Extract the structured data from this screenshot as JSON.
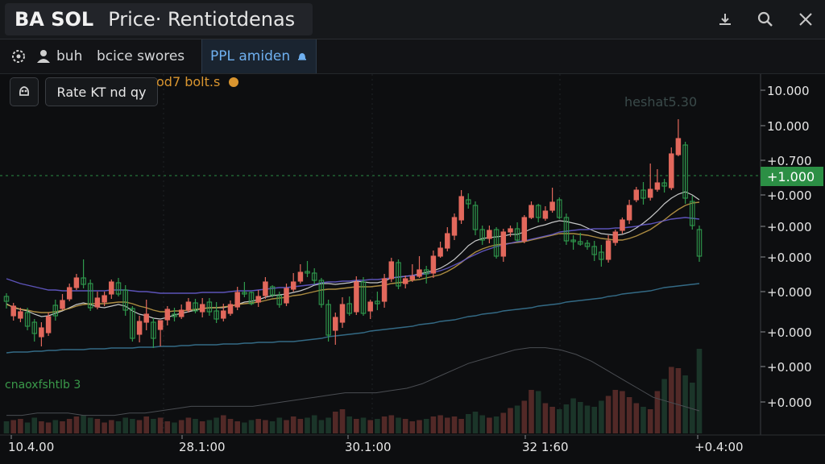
{
  "window": {
    "symbol": "BA SOL",
    "title": "Price· Rentiotdenas",
    "icons": [
      "download-icon",
      "search-icon",
      "close-icon"
    ]
  },
  "toolbar": {
    "item1_label": "buh",
    "item2_label": "bcice swores",
    "active_tab_label": "PPL amiden"
  },
  "chart_panel": {
    "rate_button_label": "Rate KT  nd  qy",
    "indicator_label": "od7 bolt.s",
    "watermark": "heshat5.30",
    "volume_label": "cnaoxfshtlb 3"
  },
  "colors": {
    "up": "#2f9a4d",
    "down": "#e2685c",
    "price_tag": "#2c8f45",
    "ma_fast": "#e8e8e8",
    "ma_mid": "#c9a24a",
    "ma_slow": "#6b5fd6",
    "ma_long": "#3b7a9a"
  },
  "chart_data": {
    "type": "candlestick",
    "price_axis_labels": [
      "10.000",
      "10.000",
      "+0.700",
      "+0.000",
      "+0.000",
      "+0.000",
      "+0.000",
      "+0.000",
      "+0.000",
      "+0.000"
    ],
    "current_price_tag": "+1.000",
    "time_axis_labels": [
      "10.4.00",
      "28.1:00",
      "30.1:00",
      "32 1:60",
      "+0.4:00"
    ],
    "candles": [
      [
        368,
        374,
        383,
        364,
        0
      ],
      [
        380,
        392,
        398,
        376,
        1
      ],
      [
        395,
        387,
        400,
        382,
        1
      ],
      [
        388,
        405,
        410,
        382,
        0
      ],
      [
        400,
        414,
        424,
        396,
        0
      ],
      [
        407,
        418,
        430,
        400,
        1
      ],
      [
        413,
        393,
        417,
        388,
        1
      ],
      [
        392,
        379,
        398,
        372,
        0
      ],
      [
        383,
        373,
        385,
        365,
        1
      ],
      [
        371,
        357,
        374,
        352,
        1
      ],
      [
        357,
        345,
        360,
        340,
        1
      ],
      [
        345,
        353,
        358,
        322,
        0
      ],
      [
        352,
        382,
        386,
        347,
        0
      ],
      [
        381,
        370,
        384,
        362,
        1
      ],
      [
        375,
        367,
        380,
        362,
        1
      ],
      [
        365,
        350,
        371,
        347,
        1
      ],
      [
        351,
        365,
        368,
        345,
        0
      ],
      [
        360,
        385,
        392,
        354,
        0
      ],
      [
        383,
        420,
        424,
        380,
        0
      ],
      [
        415,
        399,
        425,
        392,
        1
      ],
      [
        400,
        390,
        410,
        372,
        1
      ],
      [
        400,
        420,
        432,
        395,
        0
      ],
      [
        409,
        398,
        430,
        404,
        1
      ],
      [
        397,
        384,
        404,
        380,
        1
      ],
      [
        390,
        393,
        399,
        382,
        0
      ],
      [
        393,
        385,
        396,
        378,
        1
      ],
      [
        385,
        375,
        388,
        370,
        1
      ],
      [
        376,
        386,
        389,
        371,
        0
      ],
      [
        387,
        378,
        394,
        370,
        1
      ],
      [
        375,
        387,
        392,
        370,
        0
      ],
      [
        386,
        396,
        401,
        375,
        0
      ],
      [
        395,
        386,
        399,
        377,
        1
      ],
      [
        389,
        378,
        392,
        373,
        1
      ],
      [
        381,
        363,
        385,
        356,
        1
      ],
      [
        364,
        363,
        369,
        350,
        0
      ],
      [
        363,
        377,
        379,
        362,
        0
      ],
      [
        375,
        368,
        381,
        360,
        1
      ],
      [
        367,
        350,
        371,
        344,
        1
      ],
      [
        356,
        366,
        369,
        354,
        0
      ],
      [
        367,
        378,
        382,
        362,
        0
      ],
      [
        376,
        358,
        380,
        352,
        1
      ],
      [
        359,
        350,
        362,
        339,
        1
      ],
      [
        349,
        338,
        352,
        328,
        1
      ],
      [
        337,
        339,
        344,
        324,
        0
      ],
      [
        339,
        348,
        353,
        333,
        0
      ],
      [
        348,
        378,
        382,
        345,
        0
      ],
      [
        378,
        416,
        424,
        372,
        0
      ],
      [
        410,
        394,
        428,
        388,
        1
      ],
      [
        400,
        378,
        407,
        369,
        1
      ],
      [
        377,
        389,
        392,
        368,
        0
      ],
      [
        387,
        350,
        391,
        343,
        1
      ],
      [
        350,
        389,
        392,
        344,
        0
      ],
      [
        386,
        375,
        396,
        372,
        1
      ],
      [
        374,
        377,
        385,
        362,
        0
      ],
      [
        374,
        346,
        382,
        340,
        1
      ],
      [
        346,
        325,
        350,
        320,
        1
      ],
      [
        326,
        355,
        359,
        322,
        0
      ],
      [
        352,
        346,
        358,
        342,
        1
      ],
      [
        347,
        343,
        350,
        328,
        1
      ],
      [
        343,
        335,
        345,
        318,
        1
      ],
      [
        335,
        340,
        352,
        330,
        0
      ],
      [
        339,
        318,
        345,
        311,
        1
      ],
      [
        318,
        308,
        320,
        300,
        1
      ],
      [
        308,
        290,
        312,
        282,
        1
      ],
      [
        292,
        270,
        298,
        265,
        1
      ],
      [
        273,
        244,
        278,
        236,
        1
      ],
      [
        248,
        253,
        259,
        240,
        0
      ],
      [
        255,
        285,
        292,
        250,
        0
      ],
      [
        285,
        298,
        304,
        280,
        0
      ],
      [
        296,
        286,
        302,
        280,
        1
      ],
      [
        285,
        318,
        321,
        282,
        0
      ],
      [
        318,
        288,
        325,
        284,
        1
      ],
      [
        288,
        284,
        294,
        280,
        1
      ],
      [
        284,
        298,
        300,
        276,
        0
      ],
      [
        299,
        270,
        302,
        267,
        1
      ],
      [
        270,
        255,
        272,
        250,
        1
      ],
      [
        255,
        270,
        276,
        253,
        0
      ],
      [
        271,
        262,
        274,
        256,
        1
      ],
      [
        261,
        251,
        264,
        233,
        1
      ],
      [
        248,
        270,
        272,
        245,
        0
      ],
      [
        270,
        299,
        304,
        265,
        0
      ],
      [
        298,
        300,
        310,
        292,
        0
      ],
      [
        300,
        303,
        305,
        289,
        0
      ],
      [
        302,
        306,
        310,
        298,
        0
      ],
      [
        306,
        316,
        324,
        299,
        0
      ],
      [
        313,
        322,
        331,
        304,
        0
      ],
      [
        322,
        299,
        326,
        292,
        1
      ],
      [
        301,
        288,
        305,
        285,
        1
      ],
      [
        286,
        273,
        290,
        270,
        1
      ],
      [
        273,
        255,
        278,
        248,
        1
      ],
      [
        248,
        236,
        251,
        232,
        1
      ],
      [
        236,
        246,
        254,
        226,
        0
      ],
      [
        245,
        235,
        249,
        203,
        1
      ],
      [
        235,
        227,
        238,
        210,
        1
      ],
      [
        227,
        231,
        239,
        222,
        0
      ],
      [
        233,
        191,
        236,
        183,
        1
      ],
      [
        192,
        172,
        194,
        148,
        1
      ],
      [
        180,
        246,
        253,
        176,
        0
      ],
      [
        250,
        280,
        285,
        243,
        0
      ],
      [
        285,
        318,
        325,
        280,
        0
      ]
    ],
    "overlay_lines": [
      {
        "name": "ma-fast",
        "values": [
          377,
          382,
          384,
          386,
          390,
          393,
          392,
          389,
          386,
          382,
          378,
          376,
          378,
          381,
          382,
          380,
          378,
          380,
          386,
          390,
          392,
          395,
          396,
          394,
          391,
          389,
          387,
          385,
          383,
          382,
          382,
          382,
          380,
          378,
          375,
          374,
          372,
          369,
          367,
          366,
          365,
          363,
          361,
          358,
          354,
          352,
          352,
          353,
          352,
          351,
          349,
          350,
          351,
          351,
          349,
          345,
          344,
          343,
          342,
          340,
          338,
          336,
          333,
          328,
          322,
          314,
          305,
          299,
          296,
          295,
          294,
          293,
          291,
          291,
          288,
          284,
          281,
          279,
          276,
          274,
          275,
          277,
          279,
          283,
          287,
          290,
          291,
          292,
          291,
          288,
          283,
          277,
          270,
          262,
          253,
          246,
          241,
          238,
          242,
          248
        ]
      },
      {
        "name": "ma-mid",
        "values": [
          378,
          381,
          384,
          385,
          387,
          388,
          388,
          387,
          385,
          383,
          380,
          378,
          377,
          377,
          377,
          376,
          375,
          375,
          377,
          380,
          382,
          385,
          387,
          387,
          386,
          386,
          385,
          384,
          383,
          382,
          382,
          381,
          380,
          378,
          377,
          376,
          375,
          373,
          371,
          370,
          369,
          367,
          366,
          364,
          362,
          360,
          359,
          359,
          358,
          357,
          356,
          356,
          356,
          355,
          354,
          352,
          351,
          350,
          348,
          347,
          345,
          343,
          341,
          337,
          332,
          326,
          319,
          313,
          309,
          306,
          304,
          303,
          302,
          301,
          300,
          298,
          296,
          294,
          292,
          290,
          290,
          290,
          291,
          292,
          294,
          296,
          297,
          298,
          298,
          296,
          293,
          289,
          285,
          279,
          273,
          266,
          260,
          255,
          252,
          251
        ]
      },
      {
        "name": "ma-slow",
        "values": [
          346,
          349,
          352,
          354,
          356,
          358,
          360,
          360,
          361,
          361,
          361,
          361,
          361,
          361,
          361,
          360,
          360,
          360,
          361,
          362,
          362,
          363,
          364,
          364,
          364,
          364,
          364,
          364,
          363,
          363,
          363,
          363,
          362,
          361,
          361,
          361,
          360,
          359,
          358,
          357,
          357,
          356,
          355,
          354,
          353,
          351,
          350,
          350,
          349,
          349,
          348,
          348,
          347,
          347,
          346,
          345,
          344,
          343,
          342,
          341,
          340,
          338,
          336,
          333,
          329,
          325,
          320,
          316,
          312,
          309,
          306,
          304,
          302,
          300,
          299,
          297,
          295,
          293,
          291,
          288,
          287,
          286,
          285,
          285,
          284,
          284,
          284,
          283,
          283,
          282,
          281,
          279,
          278,
          276,
          274,
          272,
          271,
          270,
          271,
          272
        ]
      },
      {
        "name": "ma-long",
        "values": [
          438,
          437,
          437,
          437,
          436,
          436,
          435,
          435,
          434,
          434,
          434,
          434,
          433,
          433,
          433,
          432,
          432,
          432,
          432,
          431,
          431,
          431,
          430,
          430,
          430,
          429,
          429,
          428,
          428,
          428,
          428,
          427,
          427,
          427,
          426,
          426,
          425,
          425,
          425,
          424,
          424,
          424,
          423,
          422,
          421,
          420,
          418,
          417,
          416,
          415,
          414,
          413,
          411,
          410,
          409,
          408,
          407,
          406,
          405,
          403,
          402,
          401,
          399,
          398,
          397,
          395,
          393,
          392,
          390,
          389,
          388,
          386,
          385,
          384,
          383,
          382,
          380,
          379,
          378,
          377,
          375,
          374,
          373,
          372,
          371,
          370,
          368,
          367,
          365,
          364,
          363,
          362,
          361,
          359,
          357,
          356,
          355,
          354,
          353,
          352
        ]
      }
    ],
    "volume_values": [
      20,
      22,
      24,
      18,
      26,
      20,
      18,
      22,
      20,
      24,
      28,
      30,
      26,
      24,
      18,
      22,
      20,
      26,
      24,
      22,
      28,
      24,
      26,
      20,
      18,
      22,
      26,
      24,
      20,
      22,
      26,
      30,
      24,
      20,
      18,
      22,
      24,
      22,
      20,
      26,
      22,
      28,
      24,
      26,
      30,
      22,
      26,
      36,
      40,
      28,
      24,
      26,
      22,
      24,
      28,
      30,
      26,
      24,
      20,
      22,
      24,
      28,
      30,
      26,
      28,
      24,
      32,
      36,
      30,
      26,
      28,
      34,
      42,
      46,
      54,
      72,
      70,
      50,
      44,
      40,
      48,
      58,
      52,
      46,
      44,
      54,
      62,
      72,
      70,
      60,
      50,
      44,
      40,
      70,
      90,
      110,
      108,
      96,
      84,
      140
    ],
    "volume_oscillator": [
      0.08,
      0.08,
      0.09,
      0.09,
      0.09,
      0.08,
      0.08,
      0.08,
      0.09,
      0.09,
      0.1,
      0.11,
      0.12,
      0.12,
      0.12,
      0.12,
      0.12,
      0.13,
      0.14,
      0.15,
      0.16,
      0.17,
      0.18,
      0.18,
      0.18,
      0.19,
      0.2,
      0.22,
      0.25,
      0.28,
      0.31,
      0.33,
      0.35,
      0.37,
      0.38,
      0.38,
      0.37,
      0.35,
      0.32,
      0.28,
      0.24,
      0.2,
      0.16,
      0.14,
      0.12,
      0.1
    ]
  }
}
